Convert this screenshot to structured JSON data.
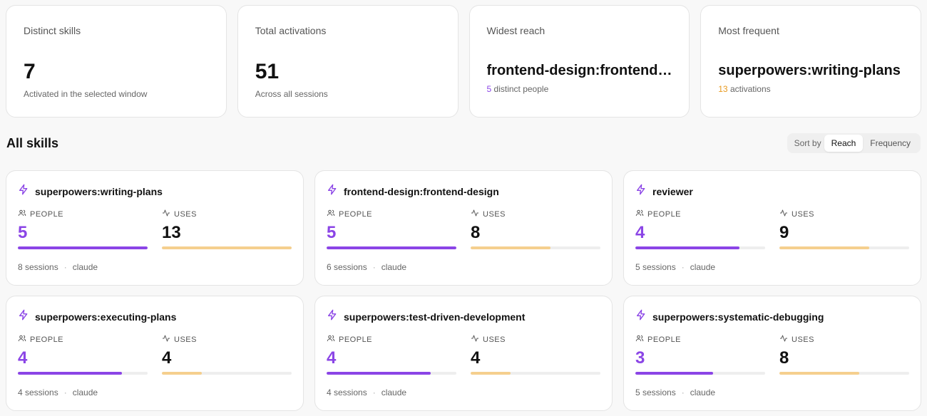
{
  "stats": [
    {
      "label": "Distinct skills",
      "value": "7",
      "sub": "Activated in the selected window"
    },
    {
      "label": "Total activations",
      "value": "51",
      "sub": "Across all sessions"
    },
    {
      "label": "Widest reach",
      "name": "frontend-design:frontend-design",
      "count": "5",
      "sub": "distinct people"
    },
    {
      "label": "Most frequent",
      "name": "superpowers:writing-plans",
      "count": "13",
      "sub": "activations"
    }
  ],
  "section_title": "All skills",
  "sort": {
    "label": "Sort by",
    "options": [
      "Reach",
      "Frequency"
    ],
    "selected": "Reach"
  },
  "metric_labels": {
    "people": "PEOPLE",
    "uses": "USES"
  },
  "colors": {
    "people": "#8b45e6",
    "uses": "#f5cf8e",
    "accent": "#8b45e6",
    "highlight_orange": "#e89a20"
  },
  "skills": [
    {
      "name": "superpowers:writing-plans",
      "people": "5",
      "uses": "13",
      "people_frac": 1.0,
      "uses_frac": 1.0,
      "sessions": "8 sessions",
      "agent": "claude"
    },
    {
      "name": "frontend-design:frontend-design",
      "people": "5",
      "uses": "8",
      "people_frac": 1.0,
      "uses_frac": 0.615,
      "sessions": "6 sessions",
      "agent": "claude"
    },
    {
      "name": "reviewer",
      "people": "4",
      "uses": "9",
      "people_frac": 0.8,
      "uses_frac": 0.692,
      "sessions": "5 sessions",
      "agent": "claude"
    },
    {
      "name": "superpowers:executing-plans",
      "people": "4",
      "uses": "4",
      "people_frac": 0.8,
      "uses_frac": 0.308,
      "sessions": "4 sessions",
      "agent": "claude"
    },
    {
      "name": "superpowers:test-driven-development",
      "people": "4",
      "uses": "4",
      "people_frac": 0.8,
      "uses_frac": 0.308,
      "sessions": "4 sessions",
      "agent": "claude"
    },
    {
      "name": "superpowers:systematic-debugging",
      "people": "3",
      "uses": "8",
      "people_frac": 0.6,
      "uses_frac": 0.615,
      "sessions": "5 sessions",
      "agent": "claude"
    }
  ]
}
